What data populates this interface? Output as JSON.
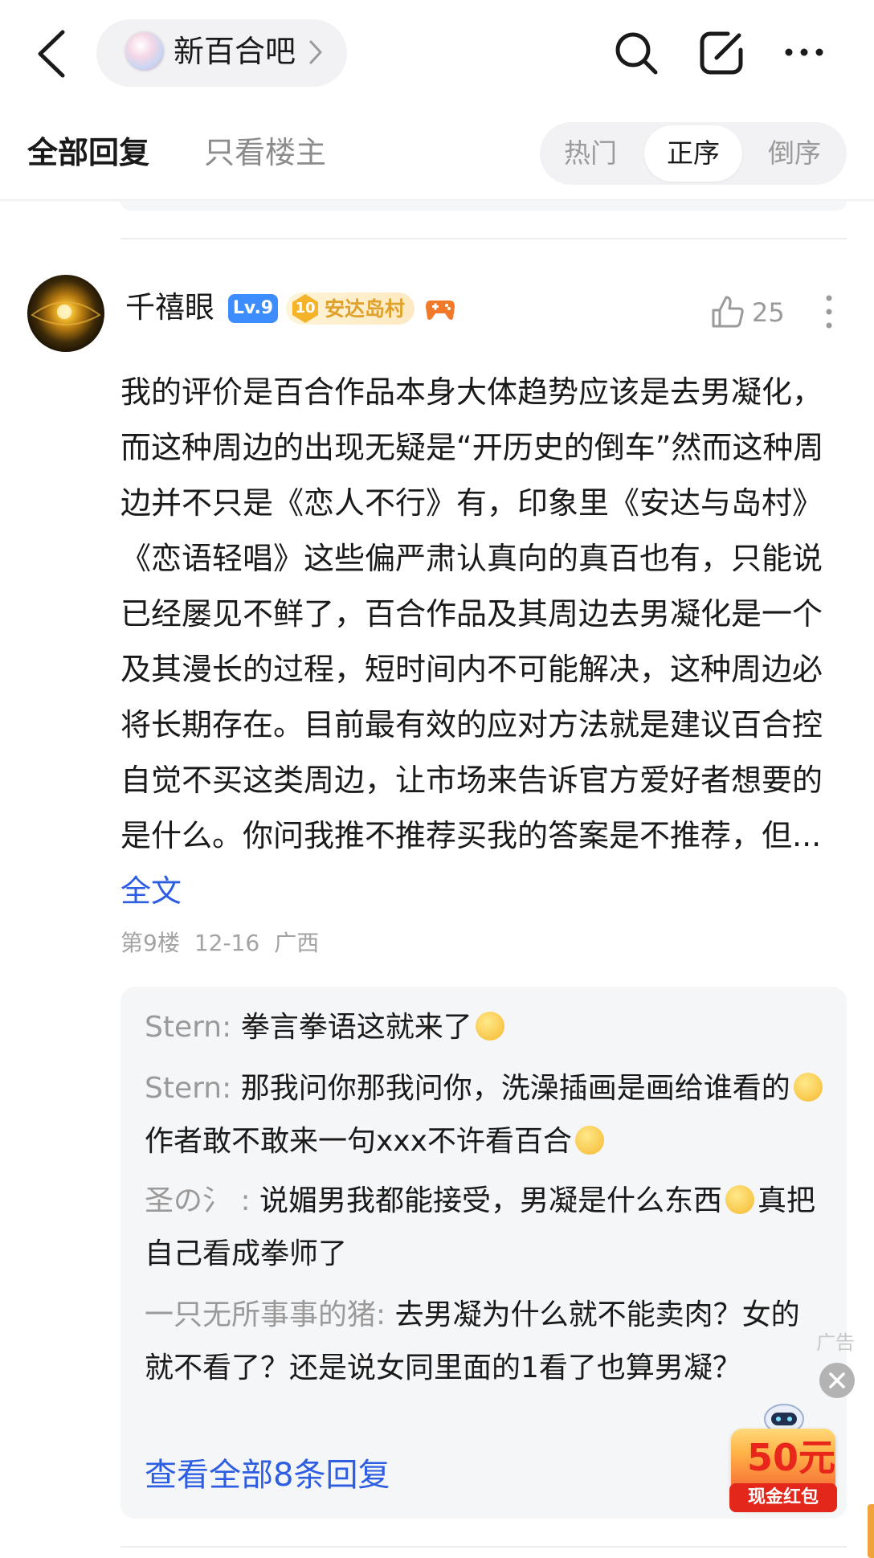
{
  "nav": {
    "forum_name": "新百合吧",
    "icons": [
      "back-icon",
      "forum-logo",
      "chevron-right-icon",
      "search-icon",
      "edit-icon",
      "more-icon"
    ]
  },
  "tabs": {
    "all_replies": "全部回复",
    "op_only": "只看楼主",
    "sort": {
      "hot": "热门",
      "asc": "正序",
      "desc": "倒序",
      "selected": "正序"
    }
  },
  "post": {
    "username": "千禧眼",
    "level": "Lv.9",
    "fan_level": "10",
    "fan_badge": "安达岛村",
    "likes": "25",
    "content": "我的评价是百合作品本身大体趋势应该是去男凝化，而这种周边的出现无疑是“开历史的倒车”然而这种周边并不只是《恋人不行》有，印象里《安达与岛村》《恋语轻唱》这些偏严肃认真向的真百也有，只能说已经屡见不鲜了，百合作品及其周边去男凝化是一个及其漫长的过程，短时间内不可能解决，这种周边必将长期存在。目前最有效的应对方法就是建议百合控自觉不买这类周边，让市场来告诉官方爱好者想要的是什么。你问我推不推荐买我的答案是不推荐，但...",
    "full_text_link": "全文",
    "floor": "第9楼",
    "date": "12-16",
    "location": "广西"
  },
  "replies": [
    {
      "author": "Stern",
      "text_a": "拳言拳语这就来了",
      "text_b": ""
    },
    {
      "author": "Stern",
      "text_a": "那我问你那我问你，洗澡插画是画给谁看的",
      "text_b": "作者敢不敢来一句xxx不许看百合"
    },
    {
      "author": "圣の氵",
      "text_a": "说媚男我都能接受，男凝是什么东西",
      "text_b": "真把自己看成拳师了"
    },
    {
      "author": "一只无所事事的猪",
      "text_a": "去男凝为什么就不能卖肉？女的就不看了？还是说女同里面的1看了也算男凝？",
      "text_b": ""
    }
  ],
  "view_all_replies": "查看全部8条回复",
  "ad": {
    "label": "广告",
    "amount": "50元",
    "caption": "现金红包"
  },
  "colors": {
    "link_blue": "#2d5de0",
    "level_blue": "#3d8dff",
    "fan_gold": "#e0a12a",
    "meta_gray": "#a3a3a3",
    "reply_bg": "#f5f6f8",
    "ad_red": "#e3281b"
  }
}
